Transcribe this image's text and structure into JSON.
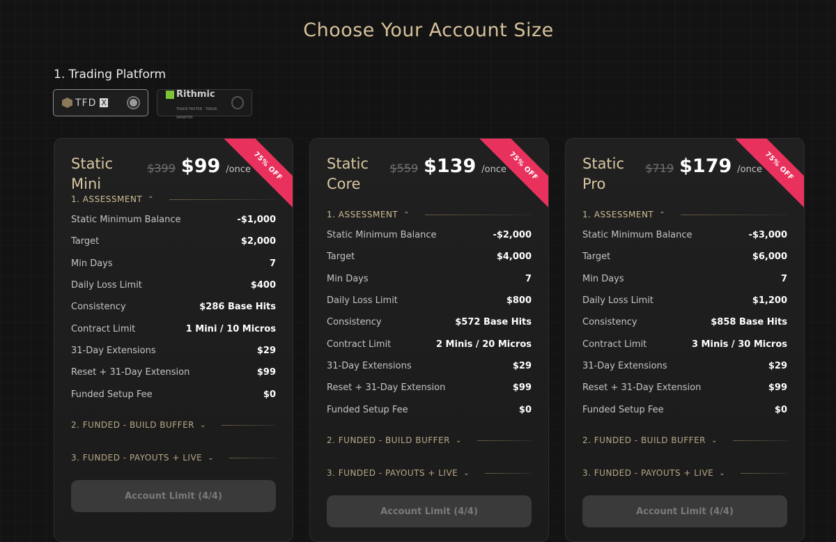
{
  "page_title": "Choose Your Account Size",
  "platform_section": {
    "label": "1. Trading Platform"
  },
  "platforms": [
    {
      "name": "TFDX",
      "logo_text": "TFD",
      "logo_suffix": "X",
      "selected": true
    },
    {
      "name": "Rithmic",
      "logo_text": "Rithmic",
      "tagline": "TRADE FASTER · TRADE SMARTER",
      "selected": false
    }
  ],
  "colors": {
    "accent": "#d6c29a",
    "ribbon": "#e8325d",
    "background": "#131313"
  },
  "plans": [
    {
      "name": "Static Mini",
      "old_price": "$399",
      "price": "$99",
      "period": "/once",
      "badge": "75% OFF",
      "sections": {
        "assessment": "1. ASSESSMENT",
        "funded_buffer": "2. FUNDED - BUILD BUFFER",
        "funded_payouts": "3. FUNDED - PAYOUTS + LIVE"
      },
      "rows": [
        {
          "label": "Static Minimum Balance",
          "value": "-$1,000"
        },
        {
          "label": "Target",
          "value": "$2,000"
        },
        {
          "label": "Min Days",
          "value": "7"
        },
        {
          "label": "Daily Loss Limit",
          "value": "$400"
        },
        {
          "label": "Consistency",
          "value": "$286 Base Hits"
        },
        {
          "label": "Contract Limit",
          "value": "1 Mini / 10 Micros"
        },
        {
          "label": "31-Day Extensions",
          "value": "$29"
        },
        {
          "label": "Reset + 31-Day Extension",
          "value": "$99"
        },
        {
          "label": "Funded Setup Fee",
          "value": "$0"
        }
      ],
      "button": "Account Limit (4/4)"
    },
    {
      "name": "Static Core",
      "old_price": "$559",
      "price": "$139",
      "period": "/once",
      "badge": "75% OFF",
      "sections": {
        "assessment": "1. ASSESSMENT",
        "funded_buffer": "2. FUNDED - BUILD BUFFER",
        "funded_payouts": "3. FUNDED - PAYOUTS + LIVE"
      },
      "rows": [
        {
          "label": "Static Minimum Balance",
          "value": "-$2,000"
        },
        {
          "label": "Target",
          "value": "$4,000"
        },
        {
          "label": "Min Days",
          "value": "7"
        },
        {
          "label": "Daily Loss Limit",
          "value": "$800"
        },
        {
          "label": "Consistency",
          "value": "$572 Base Hits"
        },
        {
          "label": "Contract Limit",
          "value": "2 Minis / 20 Micros"
        },
        {
          "label": "31-Day Extensions",
          "value": "$29"
        },
        {
          "label": "Reset + 31-Day Extension",
          "value": "$99"
        },
        {
          "label": "Funded Setup Fee",
          "value": "$0"
        }
      ],
      "button": "Account Limit (4/4)"
    },
    {
      "name": "Static Pro",
      "old_price": "$719",
      "price": "$179",
      "period": "/once",
      "badge": "75% OFF",
      "sections": {
        "assessment": "1. ASSESSMENT",
        "funded_buffer": "2. FUNDED - BUILD BUFFER",
        "funded_payouts": "3. FUNDED - PAYOUTS + LIVE"
      },
      "rows": [
        {
          "label": "Static Minimum Balance",
          "value": "-$3,000"
        },
        {
          "label": "Target",
          "value": "$6,000"
        },
        {
          "label": "Min Days",
          "value": "7"
        },
        {
          "label": "Daily Loss Limit",
          "value": "$1,200"
        },
        {
          "label": "Consistency",
          "value": "$858 Base Hits"
        },
        {
          "label": "Contract Limit",
          "value": "3 Minis / 30 Micros"
        },
        {
          "label": "31-Day Extensions",
          "value": "$29"
        },
        {
          "label": "Reset + 31-Day Extension",
          "value": "$99"
        },
        {
          "label": "Funded Setup Fee",
          "value": "$0"
        }
      ],
      "button": "Account Limit (4/4)"
    }
  ]
}
